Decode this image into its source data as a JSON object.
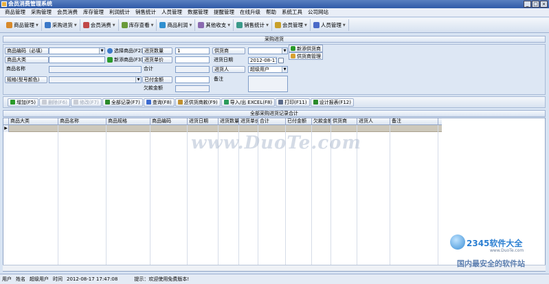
{
  "window": {
    "title": "会员消费管理系统",
    "minimize": "_",
    "maximize": "□",
    "close": "×"
  },
  "menu": [
    "商品管理",
    "采购管理",
    "会员消费",
    "库存管理",
    "利润统计",
    "销售统计",
    "人员管理",
    "数据管理",
    "提醒管理",
    "在线升级",
    "帮助",
    "系统工具",
    "公司网站"
  ],
  "toolbar": [
    {
      "label": "商品管理",
      "color": "#d88a2a"
    },
    {
      "label": "采购进货",
      "color": "#3a78c8"
    },
    {
      "label": "会员消费",
      "color": "#c04848"
    },
    {
      "label": "库存查看",
      "color": "#6a9a3a"
    },
    {
      "label": "商品利润",
      "color": "#2f8fcf"
    },
    {
      "label": "其他收支",
      "color": "#8a6ab0"
    },
    {
      "label": "销售统计",
      "color": "#3a9a8a"
    },
    {
      "label": "会员管理",
      "color": "#c8a02a"
    },
    {
      "label": "人员管理",
      "color": "#4a6ac8"
    }
  ],
  "sections": {
    "form_title": "采购进货",
    "grid_title": "全部采购进货记录合计"
  },
  "form": {
    "product_code": {
      "label": "商品编码（必填）",
      "value": ""
    },
    "select_product": "选择商品(F2)",
    "product_category": {
      "label": "商品大类",
      "value": ""
    },
    "add_product": "新添商品(F3)",
    "product_name": {
      "label": "商品名称",
      "value": ""
    },
    "spec": {
      "label": "规格(型号颜色)",
      "value": ""
    },
    "qty": {
      "label": "进货数量",
      "value": "1"
    },
    "unit_price": {
      "label": "进货单价",
      "value": ""
    },
    "total": {
      "label": "合计",
      "value": ""
    },
    "paid": {
      "label": "已付金额",
      "value": ""
    },
    "owed": {
      "label": "欠款金额",
      "value": ""
    },
    "supplier": {
      "label": "供货商",
      "value": ""
    },
    "add_supplier": "新添供货商",
    "supplier_mgmt": "供货商管理",
    "date": {
      "label": "进货日期",
      "value": "2012-08-17"
    },
    "purchaser": {
      "label": "进货人",
      "value": "超级用户"
    },
    "remark": {
      "label": "备注",
      "value": ""
    }
  },
  "actions": [
    {
      "label": "增加(F5)",
      "enabled": true,
      "color": "#2a9a2a"
    },
    {
      "label": "删除(F6)",
      "enabled": false,
      "color": "#c03030"
    },
    {
      "label": "修改(F7)",
      "enabled": false,
      "color": "#d8a030"
    },
    {
      "label": "全部记录(F7)",
      "enabled": true,
      "color": "#2a8a2a"
    },
    {
      "label": "查询(F8)",
      "enabled": true,
      "color": "#3a6ad0"
    },
    {
      "label": "还供货商款(F9)",
      "enabled": true,
      "color": "#c09030"
    },
    {
      "label": "导入/出 EXCEL(F8)",
      "enabled": true,
      "color": "#2a9a5a"
    },
    {
      "label": "打印(F11)",
      "enabled": true,
      "color": "#5a6a8a"
    },
    {
      "label": "设计报表(F12)",
      "enabled": true,
      "color": "#2a8a2a"
    }
  ],
  "grid": {
    "columns": [
      "商品大类",
      "商品名称",
      "商品规格",
      "商品编码",
      "进货日期",
      "进货数量",
      "进货单价",
      "合计",
      "已付金额",
      "欠款金额",
      "供货商",
      "进货人",
      "备注"
    ],
    "row_marker": "▶"
  },
  "watermark": "www.DuoTe.com",
  "status": {
    "user_label": "用户",
    "name_label": "姓名",
    "name_value": "超级用户",
    "time_label": "时间",
    "time_value": "2012-08-17 17:47:08",
    "tip_label": "提示：",
    "tip_value": "欢迎使用免费版本!"
  },
  "logo": {
    "brand": "2345软件大全",
    "url": "www.DuoTe.com",
    "slogan": "国内最安全的软件站"
  }
}
